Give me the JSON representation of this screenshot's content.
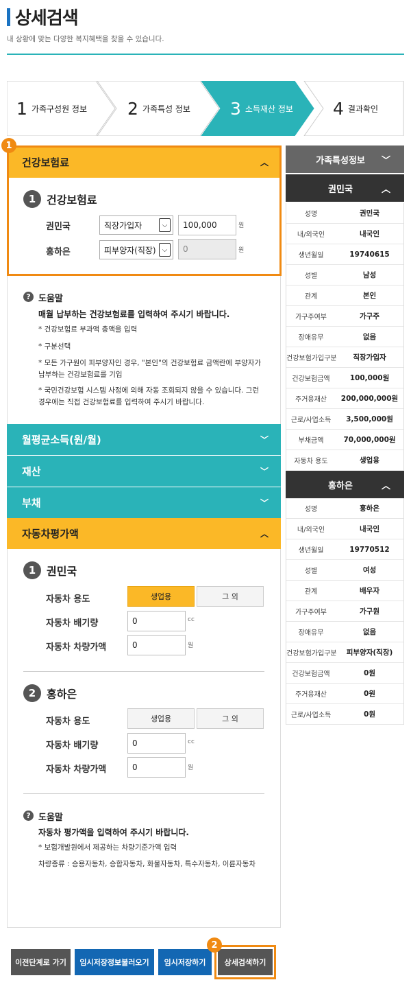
{
  "header": {
    "title": "상세검색",
    "subtitle": "내 상황에 맞는 다양한 복지혜택을 찾을 수 있습니다."
  },
  "steps": [
    {
      "num": "1",
      "label": "가족구성원 정보",
      "active": false
    },
    {
      "num": "2",
      "label": "가족특성 정보",
      "active": false
    },
    {
      "num": "3",
      "label": "소득재산 정보",
      "active": true
    },
    {
      "num": "4",
      "label": "결과확인",
      "active": false
    }
  ],
  "colors": {
    "accent_teal": "#2ab3b8",
    "accent_yellow": "#fbb827",
    "highlight_orange": "#f08a12",
    "dark_header": "#333333",
    "blue_button": "#1367b3"
  },
  "callouts": {
    "first": "1",
    "second": "2"
  },
  "health": {
    "header": "건강보험료",
    "section_num": "1",
    "section_title": "건강보험료",
    "rows": [
      {
        "name": "권민국",
        "type": "직장가입자",
        "amount": "100,000",
        "unit": "원"
      },
      {
        "name": "홍하은",
        "type": "피부양자(직장)",
        "amount": "0",
        "unit": "원"
      }
    ]
  },
  "help1": {
    "title": "도움말",
    "main": "매월 납부하는 건강보험료를 입력하여 주시기 바랍니다.",
    "lines": [
      "* 건강보험료 부과액 총액을 입력",
      "* 구분선택",
      "* 모든 가구원이 피부양자인 경우, \"본인\"의 건강보험료 금액란에 부양자가 납부하는 건강보험료를 기입",
      "* 국민건강보험 시스템 사정에 의해 자동 조회되지 않을 수 있습니다. 그런 경우에는 직접 건강보험료를 입력하여 주시기 바랍니다."
    ]
  },
  "accordions": {
    "income": "월평균소득(원/월)",
    "property": "재산",
    "debt": "부채",
    "car": "자동차평가액"
  },
  "car": {
    "labels": {
      "usage": "자동차 용도",
      "displacement": "자동차 배기량",
      "value": "자동차 차량가액"
    },
    "options": [
      "생업용",
      "그 외"
    ],
    "people": [
      {
        "num": "1",
        "name": "권민국",
        "selected": "생업용",
        "displacement": "0",
        "displacement_unit": "cc",
        "value": "0",
        "value_unit": "원"
      },
      {
        "num": "2",
        "name": "홍하은",
        "selected": "",
        "displacement": "0",
        "displacement_unit": "cc",
        "value": "0",
        "value_unit": "원"
      }
    ]
  },
  "help2": {
    "title": "도움말",
    "main": "자동차 평가액을 입력하여 주시기 바랍니다.",
    "lines": [
      "* 보험개발원에서 제공하는 차량기준가액 입력",
      "차량종류 : 승용자동차, 승합자동차, 화물자동차, 특수자동차, 이륜자동차"
    ]
  },
  "sidebar": {
    "family_header": "가족특성정보",
    "members": [
      {
        "name": "권민국",
        "rows": [
          {
            "k": "성명",
            "v": "권민국"
          },
          {
            "k": "내/외국인",
            "v": "내국인"
          },
          {
            "k": "생년월일",
            "v": "19740615"
          },
          {
            "k": "성별",
            "v": "남성"
          },
          {
            "k": "관계",
            "v": "본인"
          },
          {
            "k": "가구주여부",
            "v": "가구주"
          },
          {
            "k": "장애유무",
            "v": "없음"
          },
          {
            "k": "건강보험가입구분",
            "v": "직장가입자"
          },
          {
            "k": "건강보험금액",
            "v": "100,000원"
          },
          {
            "k": "주거용재산",
            "v": "200,000,000원"
          },
          {
            "k": "근로/사업소득",
            "v": "3,500,000원"
          },
          {
            "k": "부채금액",
            "v": "70,000,000원"
          },
          {
            "k": "자동차 용도",
            "v": "생업용"
          }
        ]
      },
      {
        "name": "홍하은",
        "rows": [
          {
            "k": "성명",
            "v": "홍하은"
          },
          {
            "k": "내/외국인",
            "v": "내국인"
          },
          {
            "k": "생년월일",
            "v": "19770512"
          },
          {
            "k": "성별",
            "v": "여성"
          },
          {
            "k": "관계",
            "v": "배우자"
          },
          {
            "k": "가구주여부",
            "v": "가구원"
          },
          {
            "k": "장애유무",
            "v": "없음"
          },
          {
            "k": "건강보험가입구분",
            "v": "피부양자(직장)"
          },
          {
            "k": "건강보험금액",
            "v": "0원"
          },
          {
            "k": "주거용재산",
            "v": "0원"
          },
          {
            "k": "근로/사업소득",
            "v": "0원"
          }
        ]
      }
    ]
  },
  "buttons": {
    "prev": "이전단계로 가기",
    "load_temp": "임시저장정보불러오기",
    "save_temp": "임시저장하기",
    "search": "상세검색하기"
  }
}
